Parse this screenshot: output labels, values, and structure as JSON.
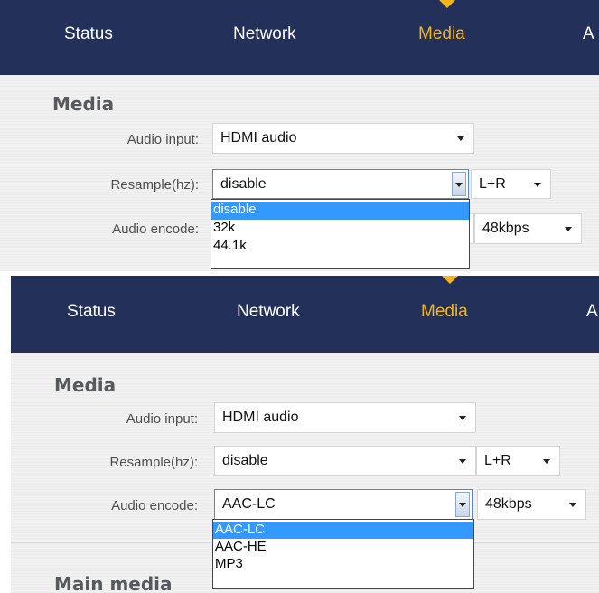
{
  "top": {
    "nav": {
      "status": "Status",
      "network": "Network",
      "media": "Media",
      "truncated": "A"
    },
    "section_title": "Media",
    "fields": {
      "audio_input": {
        "label": "Audio input:",
        "value": "HDMI audio"
      },
      "resample": {
        "label": "Resample(hz):",
        "value": "disable",
        "channel": "L+R"
      },
      "audio_encode": {
        "label": "Audio encode:",
        "bitrate": "48kbps"
      }
    },
    "dropdown_options": [
      "disable",
      "32k",
      "44.1k"
    ]
  },
  "bottom": {
    "nav": {
      "status": "Status",
      "network": "Network",
      "media": "Media",
      "truncated": "A"
    },
    "section_title": "Media",
    "fields": {
      "audio_input": {
        "label": "Audio input:",
        "value": "HDMI audio"
      },
      "resample": {
        "label": "Resample(hz):",
        "value": "disable",
        "channel": "L+R"
      },
      "audio_encode": {
        "label": "Audio encode:",
        "value": "AAC-LC",
        "bitrate": "48kbps"
      }
    },
    "dropdown_options": [
      "AAC-LC",
      "AAC-HE",
      "MP3"
    ],
    "next_section_title": "Main media"
  },
  "colors": {
    "nav_bg": "#22305a",
    "nav_active": "#f5b418",
    "highlight": "#3399ff"
  }
}
